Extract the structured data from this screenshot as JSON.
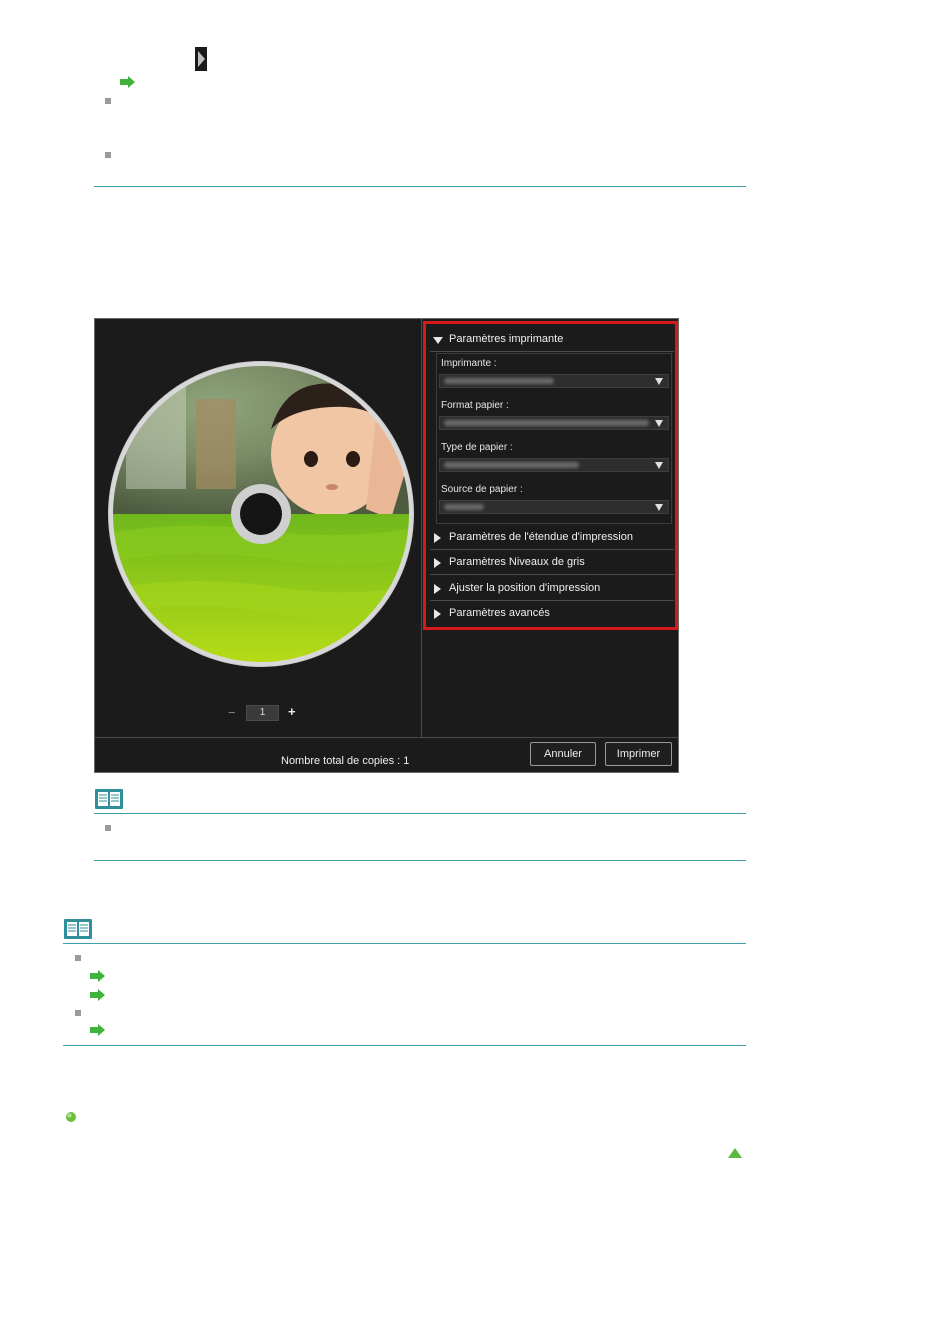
{
  "app": {
    "panel": {
      "section_printer": "Paramètres imprimante",
      "field_printer_label": "Imprimante :",
      "field_paper_size_label": "Format papier :",
      "field_media_type_label": "Type de papier :",
      "field_paper_source_label": "Source de papier :",
      "sections": [
        "Paramètres de l'étendue d'impression",
        "Paramètres Niveaux de gris",
        "Ajuster la position d'impression",
        "Paramètres avancés"
      ]
    },
    "copies_value": "1",
    "copies_minus": "−",
    "copies_plus": "+",
    "total_copies": "Nombre total de copies : 1",
    "cancel_button": "Annuler",
    "print_button": "Imprimer"
  },
  "colors": {
    "rule": "#3f9fa8",
    "highlight_box": "#d41a1a",
    "arrow_green": "#3fb33a",
    "disc_green": "#7cc41a"
  }
}
